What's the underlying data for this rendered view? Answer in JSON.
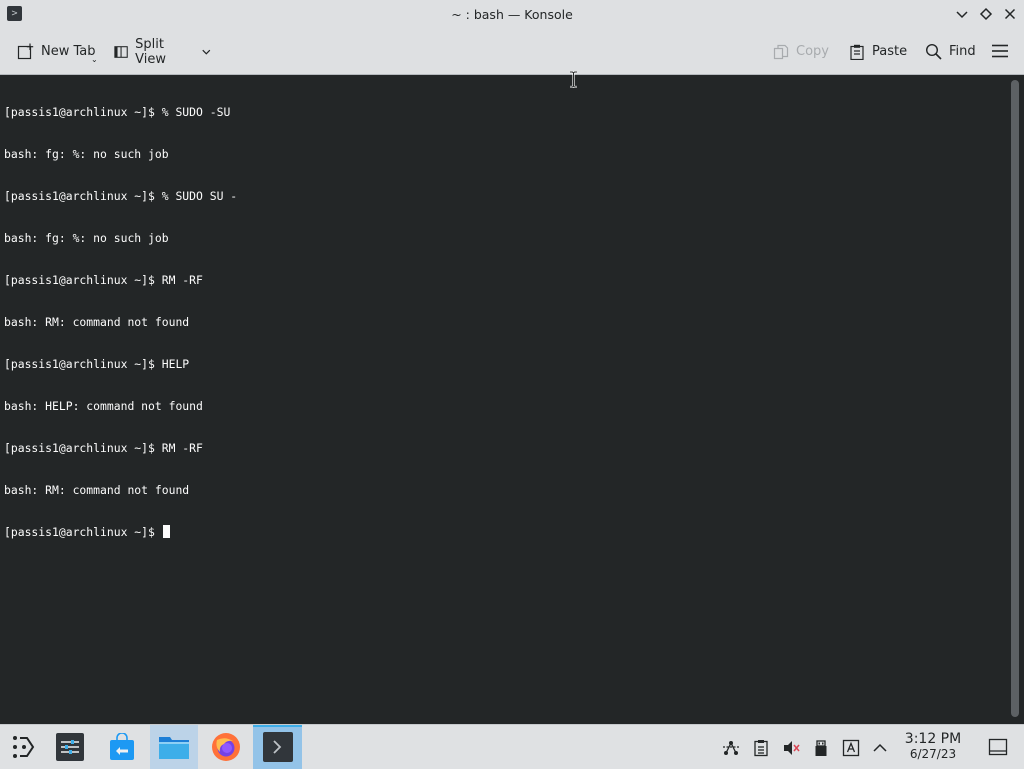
{
  "window": {
    "title": "~ : bash — Konsole",
    "app_icon": "konsole-icon",
    "controls": [
      "minimize-icon",
      "maximize-icon",
      "close-icon"
    ]
  },
  "toolbar": {
    "new_tab_label": "New Tab",
    "split_view_label": "Split View",
    "copy_label": "Copy",
    "paste_label": "Paste",
    "find_label": "Find",
    "menu_icon": "hamburger-menu-icon"
  },
  "terminal": {
    "lines": [
      "[passis1@archlinux ~]$ % SUDO -SU",
      "bash: fg: %: no such job",
      "[passis1@archlinux ~]$ % SUDO SU -",
      "bash: fg: %: no such job",
      "[passis1@archlinux ~]$ RM -RF",
      "bash: RM: command not found",
      "[passis1@archlinux ~]$ HELP",
      "bash: HELP: command not found",
      "[passis1@archlinux ~]$ RM -RF",
      "bash: RM: command not found"
    ],
    "prompt": "[passis1@archlinux ~]$ "
  },
  "taskbar": {
    "apps": [
      "application-launcher-icon",
      "system-settings-icon",
      "discover-store-icon",
      "dolphin-file-manager-icon",
      "firefox-icon",
      "konsole-icon"
    ],
    "tray": [
      "network-icon",
      "clipboard-icon",
      "volume-muted-icon",
      "usb-device-icon",
      "keyboard-layout-icon",
      "expand-tray-icon"
    ],
    "clock_time": "3:12 PM",
    "clock_date": "6/27/23",
    "show_desktop_icon": "show-desktop-icon"
  },
  "colors": {
    "terminal_bg": "#232627",
    "terminal_fg": "#fcfcfc",
    "chrome_bg": "#dee0e2",
    "accent": "#3daee9"
  }
}
